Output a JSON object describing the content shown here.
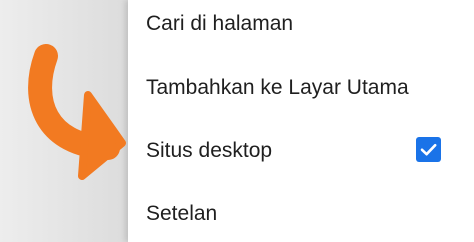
{
  "menu": {
    "items": [
      {
        "label": "Cari di halaman",
        "checked": null
      },
      {
        "label": "Tambahkan ke Layar Utama",
        "checked": null
      },
      {
        "label": "Situs desktop",
        "checked": true
      },
      {
        "label": "Setelan",
        "checked": null
      }
    ]
  },
  "icons": {
    "checkbox": "checkbox-checked-icon",
    "annotation": "orange-arrow-annotation"
  },
  "colors": {
    "checkbox": "#1a73e8",
    "arrow": "#f27a21"
  }
}
